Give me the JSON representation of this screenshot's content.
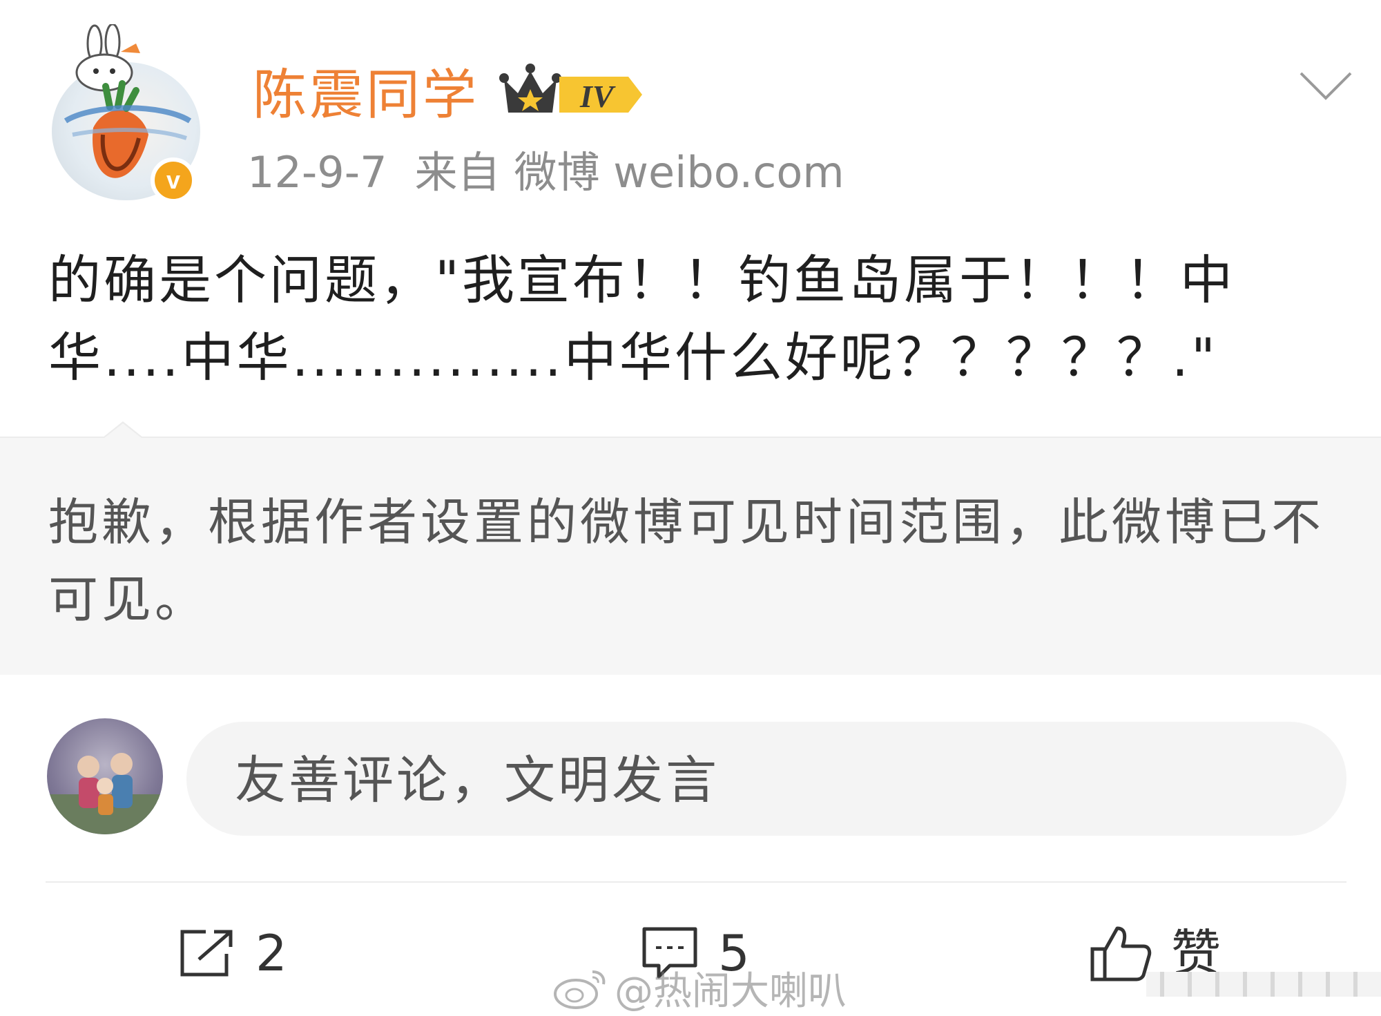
{
  "header": {
    "username": "陈震同学",
    "level_badge": "IV",
    "verified_mark": "v",
    "date": "12-9-7",
    "source_prefix": "来自",
    "source": "微博 weibo.com"
  },
  "post": {
    "text": "的确是个问题，\"我宣布！！钓鱼岛属于！！！中华....中华..............中华什么好呢？？？？？.\""
  },
  "notice": {
    "text": "抱歉，根据作者设置的微博可见时间范围，此微博已不可见。"
  },
  "comment_box": {
    "placeholder": "友善评论，文明发言"
  },
  "actions": {
    "repost_count": "2",
    "comment_count": "5",
    "like_label": "赞"
  },
  "watermark": {
    "text": "@热闹大喇叭"
  },
  "colors": {
    "username": "#ee8135",
    "verified": "#f4a51c",
    "notice_bg": "#f6f6f6"
  },
  "icons": [
    "chevron-down-icon",
    "verified-icon",
    "crown-icon",
    "repost-icon",
    "comment-icon",
    "like-icon",
    "weibo-logo-icon"
  ]
}
